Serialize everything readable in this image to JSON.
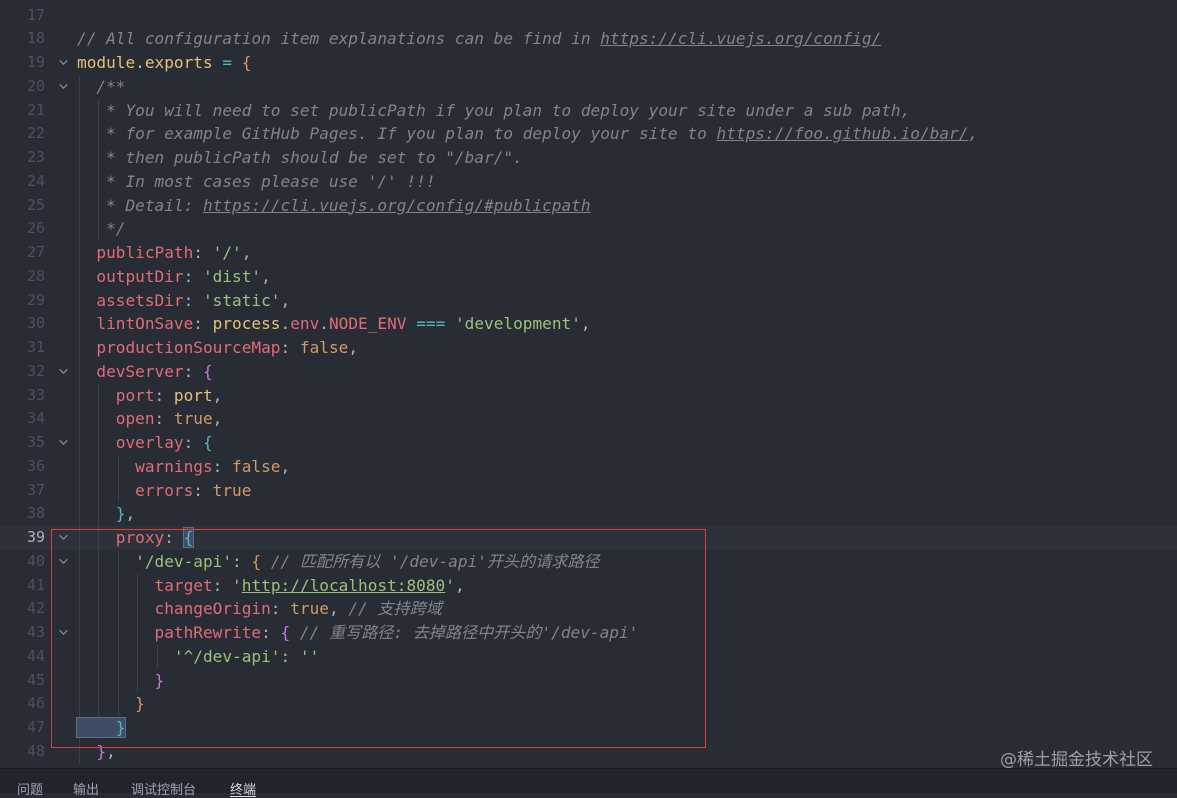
{
  "editor": {
    "active_line": "39",
    "lines": [
      {
        "n": "17",
        "fold": false,
        "guides": [],
        "tokens": []
      },
      {
        "n": "18",
        "fold": false,
        "guides": [],
        "tokens": [
          {
            "c": "c",
            "t": "// All configuration item explanations can be find in "
          },
          {
            "c": "cu",
            "t": "https://cli.vuejs.org/config/"
          }
        ]
      },
      {
        "n": "19",
        "fold": true,
        "guides": [],
        "tokens": [
          {
            "c": "v",
            "t": "module.exports"
          },
          {
            "c": "o",
            "t": " = "
          },
          {
            "c": "br1",
            "t": "{"
          }
        ]
      },
      {
        "n": "20",
        "fold": true,
        "guides": [
          1
        ],
        "tokens": [
          {
            "c": "c",
            "t": "  /**"
          }
        ]
      },
      {
        "n": "21",
        "fold": false,
        "guides": [
          1,
          2
        ],
        "tokens": [
          {
            "c": "c",
            "t": "   * You will need to set publicPath if you plan to deploy your site under a sub path,"
          }
        ]
      },
      {
        "n": "22",
        "fold": false,
        "guides": [
          1,
          2
        ],
        "tokens": [
          {
            "c": "c",
            "t": "   * for example GitHub Pages. If you plan to deploy your site to "
          },
          {
            "c": "cu",
            "t": "https://foo.github.io/bar/"
          },
          {
            "c": "c",
            "t": ","
          }
        ]
      },
      {
        "n": "23",
        "fold": false,
        "guides": [
          1,
          2
        ],
        "tokens": [
          {
            "c": "c",
            "t": "   * then publicPath should be set to \"/bar/\"."
          }
        ]
      },
      {
        "n": "24",
        "fold": false,
        "guides": [
          1,
          2
        ],
        "tokens": [
          {
            "c": "c",
            "t": "   * In most cases please use '/' !!!"
          }
        ]
      },
      {
        "n": "25",
        "fold": false,
        "guides": [
          1,
          2
        ],
        "tokens": [
          {
            "c": "c",
            "t": "   * Detail: "
          },
          {
            "c": "cu",
            "t": "https://cli.vuejs.org/config/#publicpath"
          }
        ]
      },
      {
        "n": "26",
        "fold": false,
        "guides": [
          1,
          2
        ],
        "tokens": [
          {
            "c": "c",
            "t": "   */"
          }
        ]
      },
      {
        "n": "27",
        "fold": false,
        "guides": [
          1
        ],
        "tokens": [
          {
            "c": "p",
            "t": "  publicPath"
          },
          {
            "c": "t",
            "t": ": "
          },
          {
            "c": "s",
            "t": "'/'"
          },
          {
            "c": "t",
            "t": ","
          }
        ]
      },
      {
        "n": "28",
        "fold": false,
        "guides": [
          1
        ],
        "tokens": [
          {
            "c": "p",
            "t": "  outputDir"
          },
          {
            "c": "t",
            "t": ": "
          },
          {
            "c": "s",
            "t": "'dist'"
          },
          {
            "c": "t",
            "t": ","
          }
        ]
      },
      {
        "n": "29",
        "fold": false,
        "guides": [
          1
        ],
        "tokens": [
          {
            "c": "p",
            "t": "  assetsDir"
          },
          {
            "c": "t",
            "t": ": "
          },
          {
            "c": "s",
            "t": "'static'"
          },
          {
            "c": "t",
            "t": ","
          }
        ]
      },
      {
        "n": "30",
        "fold": false,
        "guides": [
          1
        ],
        "tokens": [
          {
            "c": "p",
            "t": "  lintOnSave"
          },
          {
            "c": "t",
            "t": ": "
          },
          {
            "c": "v",
            "t": "process"
          },
          {
            "c": "t",
            "t": "."
          },
          {
            "c": "p",
            "t": "env"
          },
          {
            "c": "t",
            "t": "."
          },
          {
            "c": "p",
            "t": "NODE_ENV"
          },
          {
            "c": "o",
            "t": " === "
          },
          {
            "c": "s",
            "t": "'development'"
          },
          {
            "c": "t",
            "t": ","
          }
        ]
      },
      {
        "n": "31",
        "fold": false,
        "guides": [
          1
        ],
        "tokens": [
          {
            "c": "p",
            "t": "  productionSourceMap"
          },
          {
            "c": "t",
            "t": ": "
          },
          {
            "c": "k",
            "t": "false"
          },
          {
            "c": "t",
            "t": ","
          }
        ]
      },
      {
        "n": "32",
        "fold": true,
        "guides": [
          1
        ],
        "tokens": [
          {
            "c": "p",
            "t": "  devServer"
          },
          {
            "c": "t",
            "t": ": "
          },
          {
            "c": "br2",
            "t": "{"
          }
        ]
      },
      {
        "n": "33",
        "fold": false,
        "guides": [
          1,
          2
        ],
        "tokens": [
          {
            "c": "p",
            "t": "    port"
          },
          {
            "c": "t",
            "t": ": "
          },
          {
            "c": "v",
            "t": "port"
          },
          {
            "c": "t",
            "t": ","
          }
        ]
      },
      {
        "n": "34",
        "fold": false,
        "guides": [
          1,
          2
        ],
        "tokens": [
          {
            "c": "p",
            "t": "    open"
          },
          {
            "c": "t",
            "t": ": "
          },
          {
            "c": "k",
            "t": "true"
          },
          {
            "c": "t",
            "t": ","
          }
        ]
      },
      {
        "n": "35",
        "fold": true,
        "guides": [
          1,
          2
        ],
        "tokens": [
          {
            "c": "p",
            "t": "    overlay"
          },
          {
            "c": "t",
            "t": ": "
          },
          {
            "c": "br3",
            "t": "{"
          }
        ]
      },
      {
        "n": "36",
        "fold": false,
        "guides": [
          1,
          2,
          3
        ],
        "tokens": [
          {
            "c": "p",
            "t": "      warnings"
          },
          {
            "c": "t",
            "t": ": "
          },
          {
            "c": "k",
            "t": "false"
          },
          {
            "c": "t",
            "t": ","
          }
        ]
      },
      {
        "n": "37",
        "fold": false,
        "guides": [
          1,
          2,
          3
        ],
        "tokens": [
          {
            "c": "p",
            "t": "      errors"
          },
          {
            "c": "t",
            "t": ": "
          },
          {
            "c": "k",
            "t": "true"
          }
        ]
      },
      {
        "n": "38",
        "fold": false,
        "guides": [
          1,
          2
        ],
        "tokens": [
          {
            "c": "br3",
            "t": "    }"
          },
          {
            "c": "t",
            "t": ","
          }
        ]
      },
      {
        "n": "39",
        "fold": true,
        "guides": [
          1,
          2
        ],
        "tokens": [
          {
            "c": "p",
            "t": "    proxy"
          },
          {
            "c": "t",
            "t": ": "
          },
          {
            "c": "br3 hl",
            "t": "{"
          }
        ]
      },
      {
        "n": "40",
        "fold": true,
        "guides": [
          1,
          2,
          3
        ],
        "tokens": [
          {
            "c": "s",
            "t": "      '/dev-api'"
          },
          {
            "c": "t",
            "t": ": "
          },
          {
            "c": "br1",
            "t": "{"
          },
          {
            "c": "c",
            "t": " // 匹配所有以 '/dev-api'开头的请求路径"
          }
        ]
      },
      {
        "n": "41",
        "fold": false,
        "guides": [
          1,
          2,
          3,
          4
        ],
        "tokens": [
          {
            "c": "p",
            "t": "        target"
          },
          {
            "c": "t",
            "t": ": "
          },
          {
            "c": "s",
            "t": "'"
          },
          {
            "c": "su",
            "t": "http://localhost:8080"
          },
          {
            "c": "s",
            "t": "'"
          },
          {
            "c": "t",
            "t": ","
          }
        ]
      },
      {
        "n": "42",
        "fold": false,
        "guides": [
          1,
          2,
          3,
          4
        ],
        "tokens": [
          {
            "c": "p",
            "t": "        changeOrigin"
          },
          {
            "c": "t",
            "t": ": "
          },
          {
            "c": "k",
            "t": "true"
          },
          {
            "c": "t",
            "t": ","
          },
          {
            "c": "c",
            "t": " // 支持跨域"
          }
        ]
      },
      {
        "n": "43",
        "fold": true,
        "guides": [
          1,
          2,
          3,
          4
        ],
        "tokens": [
          {
            "c": "p",
            "t": "        pathRewrite"
          },
          {
            "c": "t",
            "t": ": "
          },
          {
            "c": "br2",
            "t": "{"
          },
          {
            "c": "c",
            "t": " // 重写路径: 去掉路径中开头的'/dev-api'"
          }
        ]
      },
      {
        "n": "44",
        "fold": false,
        "guides": [
          1,
          2,
          3,
          4,
          5
        ],
        "tokens": [
          {
            "c": "s",
            "t": "          '^/dev-api'"
          },
          {
            "c": "t",
            "t": ": "
          },
          {
            "c": "s",
            "t": "''"
          }
        ]
      },
      {
        "n": "45",
        "fold": false,
        "guides": [
          1,
          2,
          3,
          4
        ],
        "tokens": [
          {
            "c": "br2",
            "t": "        }"
          }
        ]
      },
      {
        "n": "46",
        "fold": false,
        "guides": [
          1,
          2,
          3
        ],
        "tokens": [
          {
            "c": "br1",
            "t": "      }"
          }
        ]
      },
      {
        "n": "47",
        "fold": false,
        "guides": [
          1,
          2
        ],
        "tokens": [
          {
            "c": "br3 hl",
            "t": "    }"
          }
        ]
      },
      {
        "n": "48",
        "fold": false,
        "guides": [
          1
        ],
        "tokens": [
          {
            "c": "br2",
            "t": "  }"
          },
          {
            "c": "t",
            "t": ","
          }
        ]
      }
    ]
  },
  "panel": {
    "tabs": [
      {
        "label": "问题",
        "active": false
      },
      {
        "label": "输出",
        "active": false
      },
      {
        "label": "调试控制台",
        "active": false
      },
      {
        "label": "终端",
        "active": true
      }
    ]
  },
  "watermark": "@稀土掘金技术社区",
  "colors": {
    "background": "#282c34",
    "highlight_box": "#e03b3b",
    "comment": "#7f848e",
    "property": "#e06c75",
    "string": "#98c379",
    "keyword": "#d19a66"
  }
}
